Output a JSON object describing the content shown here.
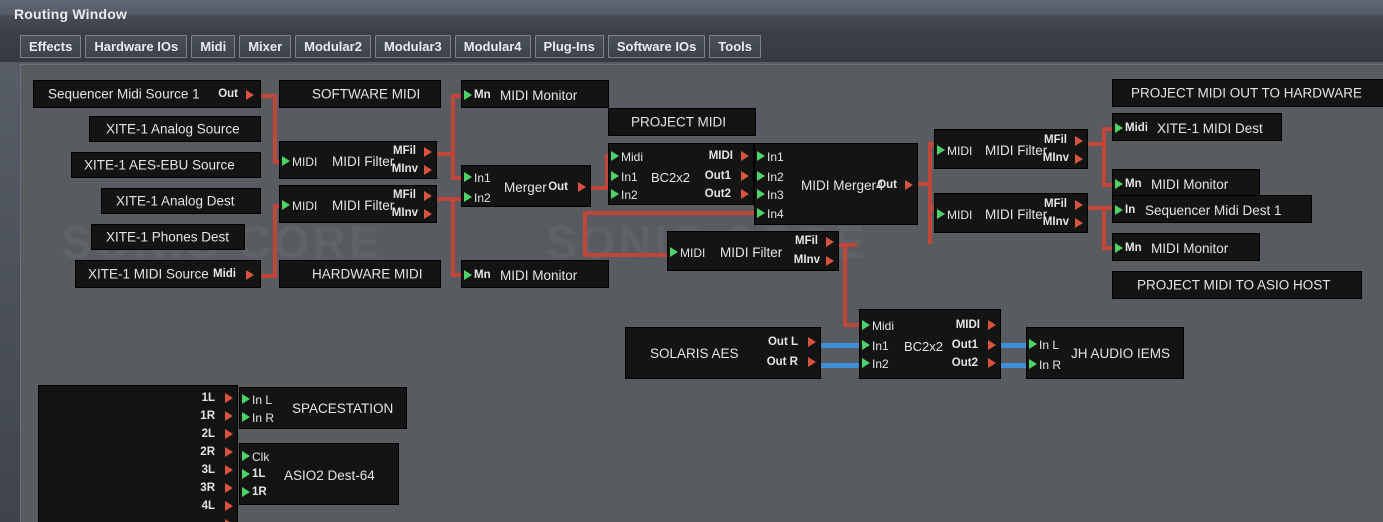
{
  "window": {
    "title": "Routing Window"
  },
  "tabs": [
    {
      "label": "Effects"
    },
    {
      "label": "Hardware IOs"
    },
    {
      "label": "Midi"
    },
    {
      "label": "Mixer"
    },
    {
      "label": "Modular2"
    },
    {
      "label": "Modular3"
    },
    {
      "label": "Modular4"
    },
    {
      "label": "Plug-Ins"
    },
    {
      "label": "Software IOs"
    },
    {
      "label": "Tools"
    }
  ],
  "watermarks": [
    {
      "text": "SONIC CORE"
    },
    {
      "text": "SONIC CORE"
    }
  ],
  "colors": {
    "canvas_bg": "#585c61",
    "block_bg": "#141414",
    "midi_cable": "#c1453a",
    "audio_cable": "#3f8fd8",
    "input_port": "#4fd267",
    "output_port": "#d9543f",
    "text": "#e3e5e2"
  },
  "blocks": {
    "seq_midi_source": {
      "name": "Sequencer Midi Source 1",
      "out": "Out"
    },
    "xite_analog_source": {
      "name": "XITE-1 Analog Source"
    },
    "xite_aes_source": {
      "name": "XITE-1 AES-EBU Source"
    },
    "xite_analog_dest": {
      "name": "XITE-1 Analog Dest"
    },
    "xite_phones_dest": {
      "name": "XITE-1 Phones Dest"
    },
    "xite_midi_source": {
      "name": "XITE-1 MIDI Source",
      "out": "Midi"
    },
    "software_midi": {
      "name": "SOFTWARE MIDI"
    },
    "hardware_midi": {
      "name": "HARDWARE MIDI"
    },
    "filter_a": {
      "name": "MIDI Filter",
      "in": "MIDI",
      "out1": "MFil",
      "out2": "MInv"
    },
    "filter_b": {
      "name": "MIDI Filter",
      "in": "MIDI",
      "out1": "MFil",
      "out2": "MInv"
    },
    "monitor_1": {
      "name": "MIDI Monitor",
      "in": "Mn"
    },
    "monitor_2": {
      "name": "MIDI Monitor",
      "in": "Mn"
    },
    "merger": {
      "name": "Merger",
      "in1": "In1",
      "in2": "In2",
      "out": "Out"
    },
    "project_midi": {
      "name": "PROJECT MIDI"
    },
    "bc2x2_top": {
      "name": "BC2x2",
      "in_midi": "Midi",
      "in1": "In1",
      "in2": "In2",
      "out_midi": "MIDI",
      "out1": "Out1",
      "out2": "Out2"
    },
    "merger4": {
      "name": "MIDI Merger4",
      "in1": "In1",
      "in2": "In2",
      "in3": "In3",
      "in4": "In4",
      "out": "Out"
    },
    "filter_c": {
      "name": "MIDI Filter",
      "in": "MIDI",
      "out1": "MFil",
      "out2": "MInv"
    },
    "filter_d": {
      "name": "MIDI Filter",
      "in": "MIDI",
      "out1": "MFil",
      "out2": "MInv"
    },
    "filter_e": {
      "name": "MIDI Filter",
      "in": "MIDI",
      "out1": "MFil",
      "out2": "MInv"
    },
    "project_midi_out_hw": {
      "name": "PROJECT MIDI OUT TO HARDWARE"
    },
    "xite_midi_dest": {
      "name": "XITE-1 MIDI Dest",
      "in": "Midi"
    },
    "monitor_3": {
      "name": "MIDI Monitor",
      "in": "Mn"
    },
    "seq_midi_dest": {
      "name": "Sequencer Midi Dest 1",
      "in": "In"
    },
    "monitor_4": {
      "name": "MIDI Monitor",
      "in": "Mn"
    },
    "project_midi_asio": {
      "name": "PROJECT MIDI TO ASIO HOST"
    },
    "solaris_aes": {
      "name": "SOLARIS AES",
      "outL": "Out L",
      "outR": "Out R"
    },
    "bc2x2_bottom": {
      "name": "BC2x2",
      "in_midi": "Midi",
      "in1": "In1",
      "in2": "In2",
      "out_midi": "MIDI",
      "out1": "Out1",
      "out2": "Out2"
    },
    "jh_audio": {
      "name": "JH AUDIO IEMS",
      "inL": "In L",
      "inR": "In R"
    },
    "source_matrix": {
      "outs": [
        "1L",
        "1R",
        "2L",
        "2R",
        "3L",
        "3R",
        "4L"
      ]
    },
    "spacestation": {
      "name": "SPACESTATION",
      "inL": "In L",
      "inR": "In R"
    },
    "asio2_dest": {
      "name": "ASIO2 Dest-64",
      "clk": "Clk",
      "in1": "1L",
      "in2": "1R"
    }
  }
}
